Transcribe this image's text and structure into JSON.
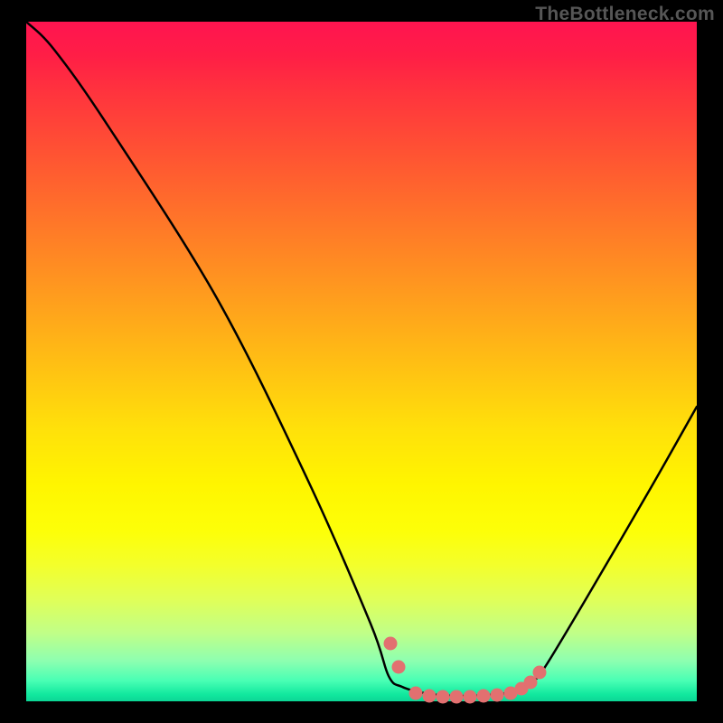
{
  "watermark": "TheBottleneck.com",
  "chart_data": {
    "type": "line",
    "title": "",
    "xlabel": "",
    "ylabel": "",
    "xlim": [
      29,
      771
    ],
    "ylim": [
      24,
      776
    ],
    "series": [
      {
        "name": "bottleneck-curve",
        "color": "#000000",
        "points": [
          [
            29,
            24
          ],
          [
            60,
            55
          ],
          [
            120,
            140
          ],
          [
            240,
            330
          ],
          [
            340,
            530
          ],
          [
            410,
            690
          ],
          [
            430,
            748
          ],
          [
            445,
            760
          ],
          [
            470,
            767
          ],
          [
            500,
            770
          ],
          [
            540,
            769
          ],
          [
            570,
            765
          ],
          [
            590,
            754
          ],
          [
            605,
            735
          ],
          [
            650,
            660
          ],
          [
            720,
            540
          ],
          [
            771,
            450
          ]
        ]
      },
      {
        "name": "highlight-dots",
        "color": "#e27070",
        "dots": [
          [
            432,
            712
          ],
          [
            441,
            738
          ],
          [
            460,
            767
          ],
          [
            475,
            770
          ],
          [
            490,
            771
          ],
          [
            505,
            771
          ],
          [
            520,
            771
          ],
          [
            535,
            770
          ],
          [
            550,
            769
          ],
          [
            565,
            767
          ],
          [
            577,
            762
          ],
          [
            587,
            755
          ],
          [
            597,
            744
          ]
        ]
      }
    ]
  }
}
